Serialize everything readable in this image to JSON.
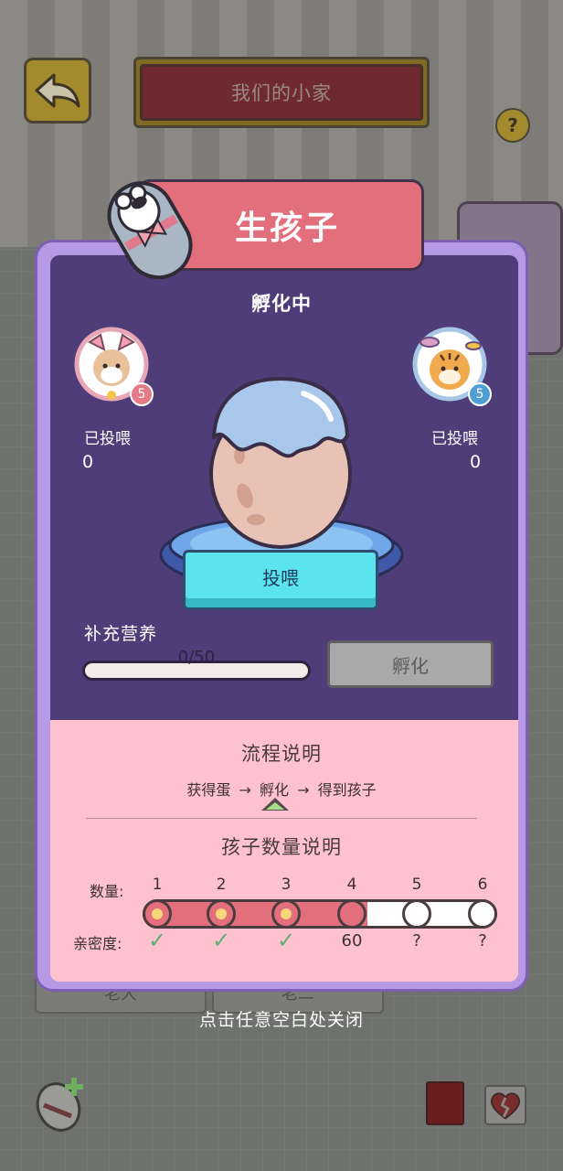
{
  "background": {
    "home_title": "我们的小家",
    "help_icon": "?",
    "tabs": [
      "老大",
      "老二"
    ]
  },
  "modal": {
    "header_title": "生孩子",
    "status": "孵化中",
    "left_parent": {
      "level": "5",
      "fed_label": "已投喂",
      "fed_value": "0"
    },
    "right_parent": {
      "level": "5",
      "fed_label": "已投喂",
      "fed_value": "0"
    },
    "feed_button": "投喂",
    "supplement_label": "补充营养",
    "progress": {
      "current": 0,
      "max": 50,
      "text": "0/50"
    },
    "hatch_button": "孵化",
    "flow": {
      "title": "流程说明",
      "steps": [
        "获得蛋",
        "孵化",
        "得到孩子"
      ],
      "arrow": "→",
      "current_step": 1
    },
    "children": {
      "title": "孩子数量说明",
      "count_label": "数量:",
      "intimacy_label": "亲密度:",
      "counts": [
        "1",
        "2",
        "3",
        "4",
        "5",
        "6"
      ],
      "intimacy": [
        "✓",
        "✓",
        "✓",
        "60",
        "?",
        "?"
      ],
      "unlocked": 4
    }
  },
  "close_hint": "点击任意空白处关闭",
  "colors": {
    "accent_pink": "#e36f7c",
    "panel_purple": "#4e3d78",
    "info_pink": "#fec2ce",
    "feed_cyan": "#5be3ee"
  }
}
